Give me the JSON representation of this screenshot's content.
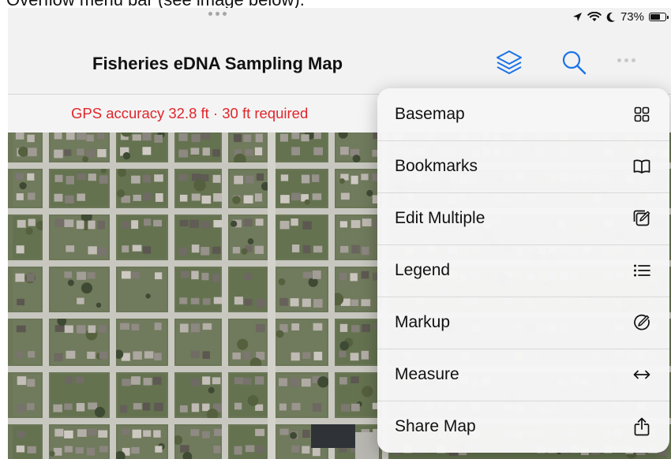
{
  "document": {
    "caption": "Overflow menu bar (see image below)."
  },
  "status_bar": {
    "battery_text": "73%",
    "battery_level": 0.73,
    "icons": [
      "location-arrow-icon",
      "wifi-icon",
      "moon-icon",
      "battery-icon"
    ]
  },
  "nav": {
    "title": "Fisheries eDNA Sampling Map",
    "layers_icon": "layers-icon",
    "search_icon": "search-icon",
    "more_icon": "more-icon",
    "accent_color": "#1a73e8"
  },
  "gps_banner": {
    "text": "GPS accuracy 32.8 ft  ·  30 ft required",
    "color": "#e0262b"
  },
  "menu": {
    "items": [
      {
        "label": "Basemap",
        "icon": "basemap-grid-icon"
      },
      {
        "label": "Bookmarks",
        "icon": "book-icon"
      },
      {
        "label": "Edit Multiple",
        "icon": "edit-multiple-icon"
      },
      {
        "label": "Legend",
        "icon": "list-icon"
      },
      {
        "label": "Markup",
        "icon": "markup-icon"
      },
      {
        "label": "Measure",
        "icon": "measure-arrows-icon"
      },
      {
        "label": "Share Map",
        "icon": "share-icon"
      }
    ]
  }
}
